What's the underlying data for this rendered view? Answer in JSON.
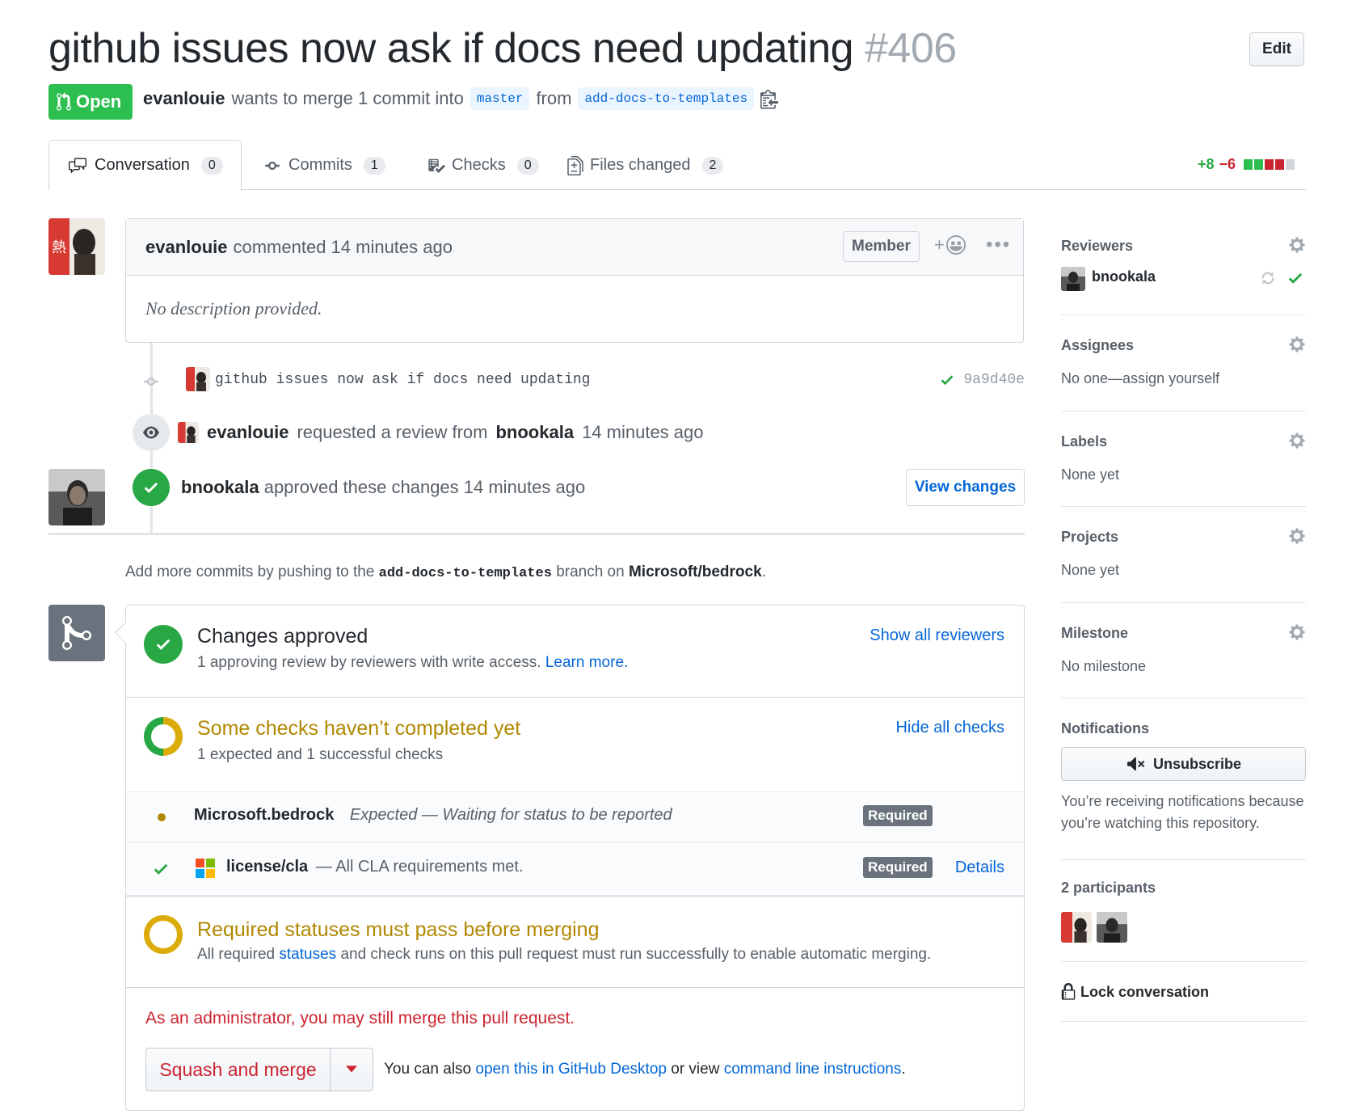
{
  "header": {
    "title": "github issues now ask if docs need updating",
    "number": "#406",
    "edit_label": "Edit",
    "state_label": "Open",
    "author": "evanlouie",
    "merge_text": "wants to merge 1 commit into",
    "base_branch": "master",
    "from_text": "from",
    "head_branch": "add-docs-to-templates"
  },
  "tabs": [
    {
      "label": "Conversation",
      "count": "0"
    },
    {
      "label": "Commits",
      "count": "1"
    },
    {
      "label": "Checks",
      "count": "0"
    },
    {
      "label": "Files changed",
      "count": "2"
    }
  ],
  "diffstat": {
    "additions": "+8",
    "deletions": "−6"
  },
  "comment": {
    "author": "evanlouie",
    "action": "commented 14 minutes ago",
    "role": "Member",
    "reaction_plus": "+",
    "more": "•••",
    "body": "No description provided."
  },
  "timeline": {
    "commit_message": "github issues now ask if docs need updating",
    "commit_sha": "9a9d40e",
    "review_request": {
      "actor": "evanlouie",
      "text": "requested a review from",
      "reviewer": "bnookala",
      "time": "14 minutes ago"
    },
    "approval": {
      "actor": "bnookala",
      "text": "approved these changes 14 minutes ago",
      "button": "View changes"
    },
    "hint": {
      "prefix": "Add more commits by pushing to the",
      "branch": "add-docs-to-templates",
      "middle": "branch on",
      "repo": "Microsoft/bedrock",
      "suffix": "."
    }
  },
  "mergebox": {
    "approved_title": "Changes approved",
    "approved_sub": "1 approving review by reviewers with write access.",
    "learn_more": "Learn more.",
    "show_reviewers": "Show all reviewers",
    "checks_title": "Some checks haven’t completed yet",
    "checks_sub": "1 expected and 1 successful checks",
    "hide_checks": "Hide all checks",
    "checks": [
      {
        "name": "Microsoft.bedrock",
        "desc": "Expected — Waiting for status to be reported",
        "badge": "Required"
      },
      {
        "name": "license/cla",
        "desc": "— All CLA requirements met.",
        "badge": "Required",
        "link": "Details"
      }
    ],
    "required_title": "Required statuses must pass before merging",
    "required_sub_prefix": "All required",
    "required_sub_link": "statuses",
    "required_sub_suffix": "and check runs on this pull request must run successfully to enable automatic merging.",
    "admin_text": "As an administrator, you may still merge this pull request.",
    "squash_label": "Squash and merge",
    "alt_prefix": "You can also",
    "alt_link1": "open this in GitHub Desktop",
    "alt_middle": "or view",
    "alt_link2": "command line instructions",
    "alt_suffix": "."
  },
  "sidebar": {
    "reviewers_label": "Reviewers",
    "reviewer_name": "bnookala",
    "assignees_label": "Assignees",
    "assignees_value": "No one—assign yourself",
    "labels_label": "Labels",
    "labels_value": "None yet",
    "projects_label": "Projects",
    "projects_value": "None yet",
    "milestone_label": "Milestone",
    "milestone_value": "No milestone",
    "notifications_label": "Notifications",
    "unsubscribe_label": "Unsubscribe",
    "notifications_text": "You’re receiving notifications because you’re watching this repository.",
    "participants_label": "2 participants",
    "lock_label": "Lock conversation"
  },
  "colors": {
    "open_green": "#2cbe4e",
    "link_blue": "#0366d6",
    "pending_yellow": "#b08800",
    "danger_red": "#cb2431"
  }
}
